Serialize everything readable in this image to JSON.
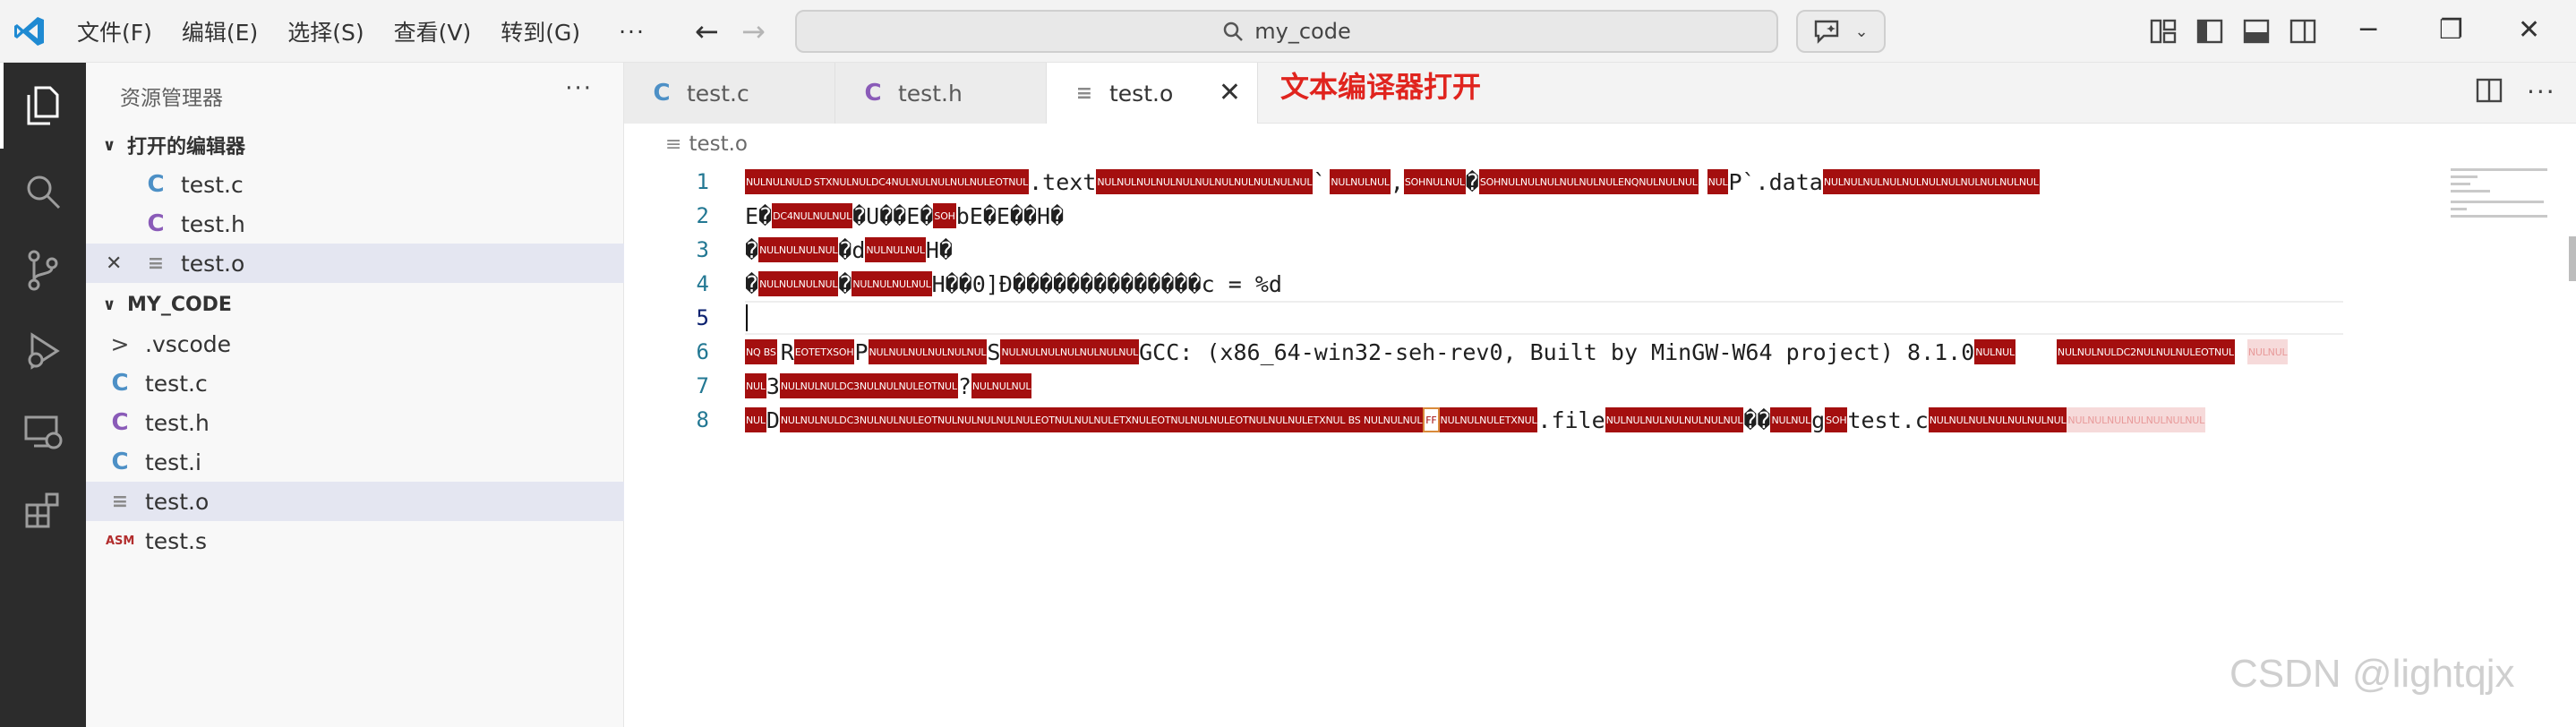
{
  "titlebar": {
    "menu": [
      "文件(F)",
      "编辑(E)",
      "选择(S)",
      "查看(V)",
      "转到(G)"
    ],
    "more": "···",
    "search_text": "my_code"
  },
  "sidebar": {
    "title": "资源管理器",
    "more": "···",
    "open_editors_label": "打开的编辑器",
    "open_editors": [
      {
        "icon": "C",
        "name": "test.c"
      },
      {
        "icon": "C",
        "name": "test.h"
      },
      {
        "icon": "≡",
        "name": "test.o"
      }
    ],
    "folder_label": "MY_CODE",
    "files": [
      {
        "icon": ">",
        "name": ".vscode"
      },
      {
        "icon": "C",
        "name": "test.c"
      },
      {
        "icon": "C",
        "name": "test.h"
      },
      {
        "icon": "C",
        "name": "test.i"
      },
      {
        "icon": "≡",
        "name": "test.o"
      },
      {
        "icon": "ASM",
        "name": "test.s"
      }
    ]
  },
  "tabs": [
    {
      "icon": "C",
      "label": "test.c"
    },
    {
      "icon": "C",
      "label": "test.h"
    },
    {
      "icon": "≡",
      "label": "test.o"
    }
  ],
  "annotation": "文本编译器打开",
  "breadcrumb": "test.o",
  "editor": {
    "line_numbers": [
      "1",
      "2",
      "3",
      "4",
      "5",
      "6",
      "7",
      "8"
    ],
    "l1": {
      "p1": "NULNULNULD",
      "t1": "STXNULNULDC4NULNULNULNULNULEOTNUL",
      "s1": ".text",
      "p2": "NULNULNULNULNULNULNULNULNULNULNUL",
      "s2": "`",
      "p3": "NULNULNUL",
      "s3": ",",
      "p4": "SOHNULNUL",
      "s4": "�",
      "p5": "SOHNULNULNULNULNULNULENQNULNULNUL",
      "p6": "NUL",
      "s5": "P`.data",
      "p7": "NULNULNULNULNULNULNULNULNULNULNUL"
    },
    "l2": {
      "s1": "E�",
      "p1": "DC4NULNULNUL",
      "s2": "�U��E�",
      "p2": "SOH",
      "s3": "bE�E��H�"
    },
    "l3": {
      "s1": "�",
      "p1": "NULNULNULNUL",
      "s2": "�d",
      "p2": "NULNULNUL",
      "s3": "H�"
    },
    "l4": {
      "s1": "�",
      "p1": "NULNULNULNUL",
      "s2": "�",
      "p2": "NULNULNULNUL",
      "s3": "H��0]Ð��������������c = %d"
    },
    "l6": {
      "p1": "NQ BS",
      "s1": "R",
      "p2": "EOTETXSOH",
      "s2": "P",
      "p3": "NULNULNULNULNULNUL",
      "s3": "S",
      "p4": "NULNULNULNULNULNULNUL",
      "s4": "GCC: (x86_64-win32-seh-rev0, Built by MinGW-W64 project) 8.1.0",
      "p5": "NULNUL",
      "p6": "NULNULNULDC2NULNULNULEOTNUL",
      "s5": "",
      "p7": "NULNUL"
    },
    "l7": {
      "p1": "NUL",
      "s1": "3",
      "p2": "NULNULNULDC3NULNULNULEOTNUL",
      "s2": "?",
      "p3": "NULNULNUL"
    },
    "l8": {
      "p1": "NUL",
      "s1": "D",
      "p2": "NULNULNULDC3NULNULNULEOTNULNULNULNULNULEOTNULNULNULETXNULEOTNULNULNULEOTNULNULNULETXNUL BS NULNULNUL",
      "ff": "FF",
      "p3": "NULNULNULETXNUL",
      "s2": ".file",
      "p4": "NULNULNULNULNULNULNUL",
      "s3": "��",
      "p5": "NULNUL",
      "s4": "g",
      "p6": "SOH",
      "s5": "test.c",
      "p7": "NULNULNULNULNULNULNUL",
      "p8": "NULNULNULNULNULNULNUL"
    }
  },
  "watermark": "CSDN @lightqjx"
}
